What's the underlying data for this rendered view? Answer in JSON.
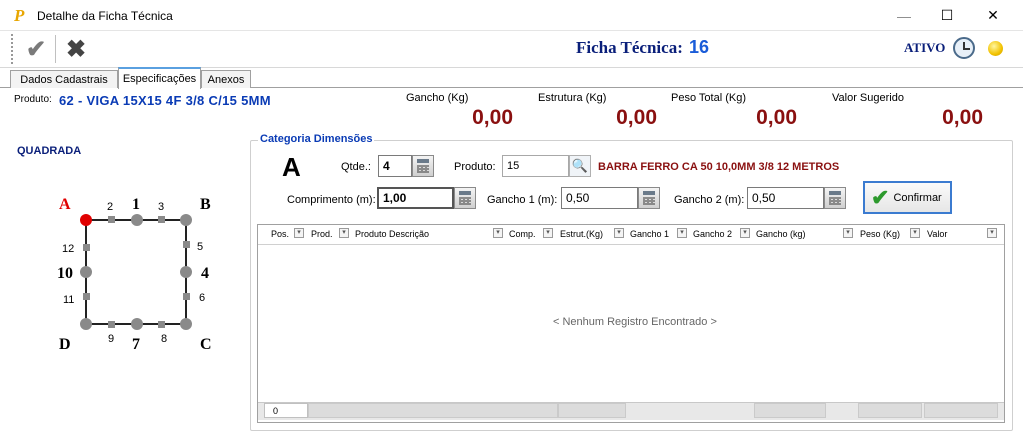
{
  "window": {
    "title": "Detalhe da Ficha Técnica",
    "logo_letter": "P",
    "minimize": "—",
    "maximize": "☐",
    "close": "✕"
  },
  "toolbar": {
    "confirm_glyph": "✔",
    "cancel_glyph": "✖",
    "ficha_label": "Ficha Técnica:",
    "ficha_number": "16",
    "status": "ATIVO",
    "status_color": "#f2c200"
  },
  "tabs": [
    {
      "label": "Dados Cadastrais",
      "active": false
    },
    {
      "label": "Especificações",
      "active": true
    },
    {
      "label": "Anexos",
      "active": false
    }
  ],
  "product": {
    "label": "Produto:",
    "value": "62 - VIGA  15X15 4F 3/8 C/15 5MM"
  },
  "summary": [
    {
      "label": "Gancho (Kg)",
      "value": "0,00"
    },
    {
      "label": "Estrutura (Kg)",
      "value": "0,00"
    },
    {
      "label": "Peso Total (Kg)",
      "value": "0,00"
    },
    {
      "label": "Valor Sugerido",
      "value": "0,00"
    }
  ],
  "shape": {
    "name": "QUADRADA",
    "corners": [
      "A",
      "B",
      "C",
      "D"
    ],
    "mids": [
      "1",
      "4",
      "7",
      "10"
    ],
    "smalls": [
      "2",
      "3",
      "5",
      "6",
      "8",
      "9",
      "11",
      "12"
    ],
    "selected_color": "#e00000"
  },
  "category": {
    "title": "Categoria Dimensões",
    "letter": "A",
    "qtde_label": "Qtde.:",
    "qtde_value": "4",
    "produto_label": "Produto:",
    "produto_value": "15",
    "produto_desc": "BARRA FERRO CA 50 10,0MM 3/8 12 METROS",
    "comprimento_label": "Comprimento (m):",
    "comprimento_value": "1,00",
    "gancho1_label": "Gancho 1 (m):",
    "gancho1_value": "0,50",
    "gancho2_label": "Gancho 2 (m):",
    "gancho2_value": "0,50",
    "confirm_label": "Confirmar"
  },
  "grid": {
    "columns": [
      "Pos.",
      "Prod.",
      "Produto Descrição",
      "Comp.",
      "Estrut.(Kg)",
      "Gancho 1",
      "Gancho 2",
      "Gancho (kg)",
      "Peso (Kg)",
      "Valor"
    ],
    "empty_text": "< Nenhum Registro Encontrado >",
    "row_count": "0"
  }
}
